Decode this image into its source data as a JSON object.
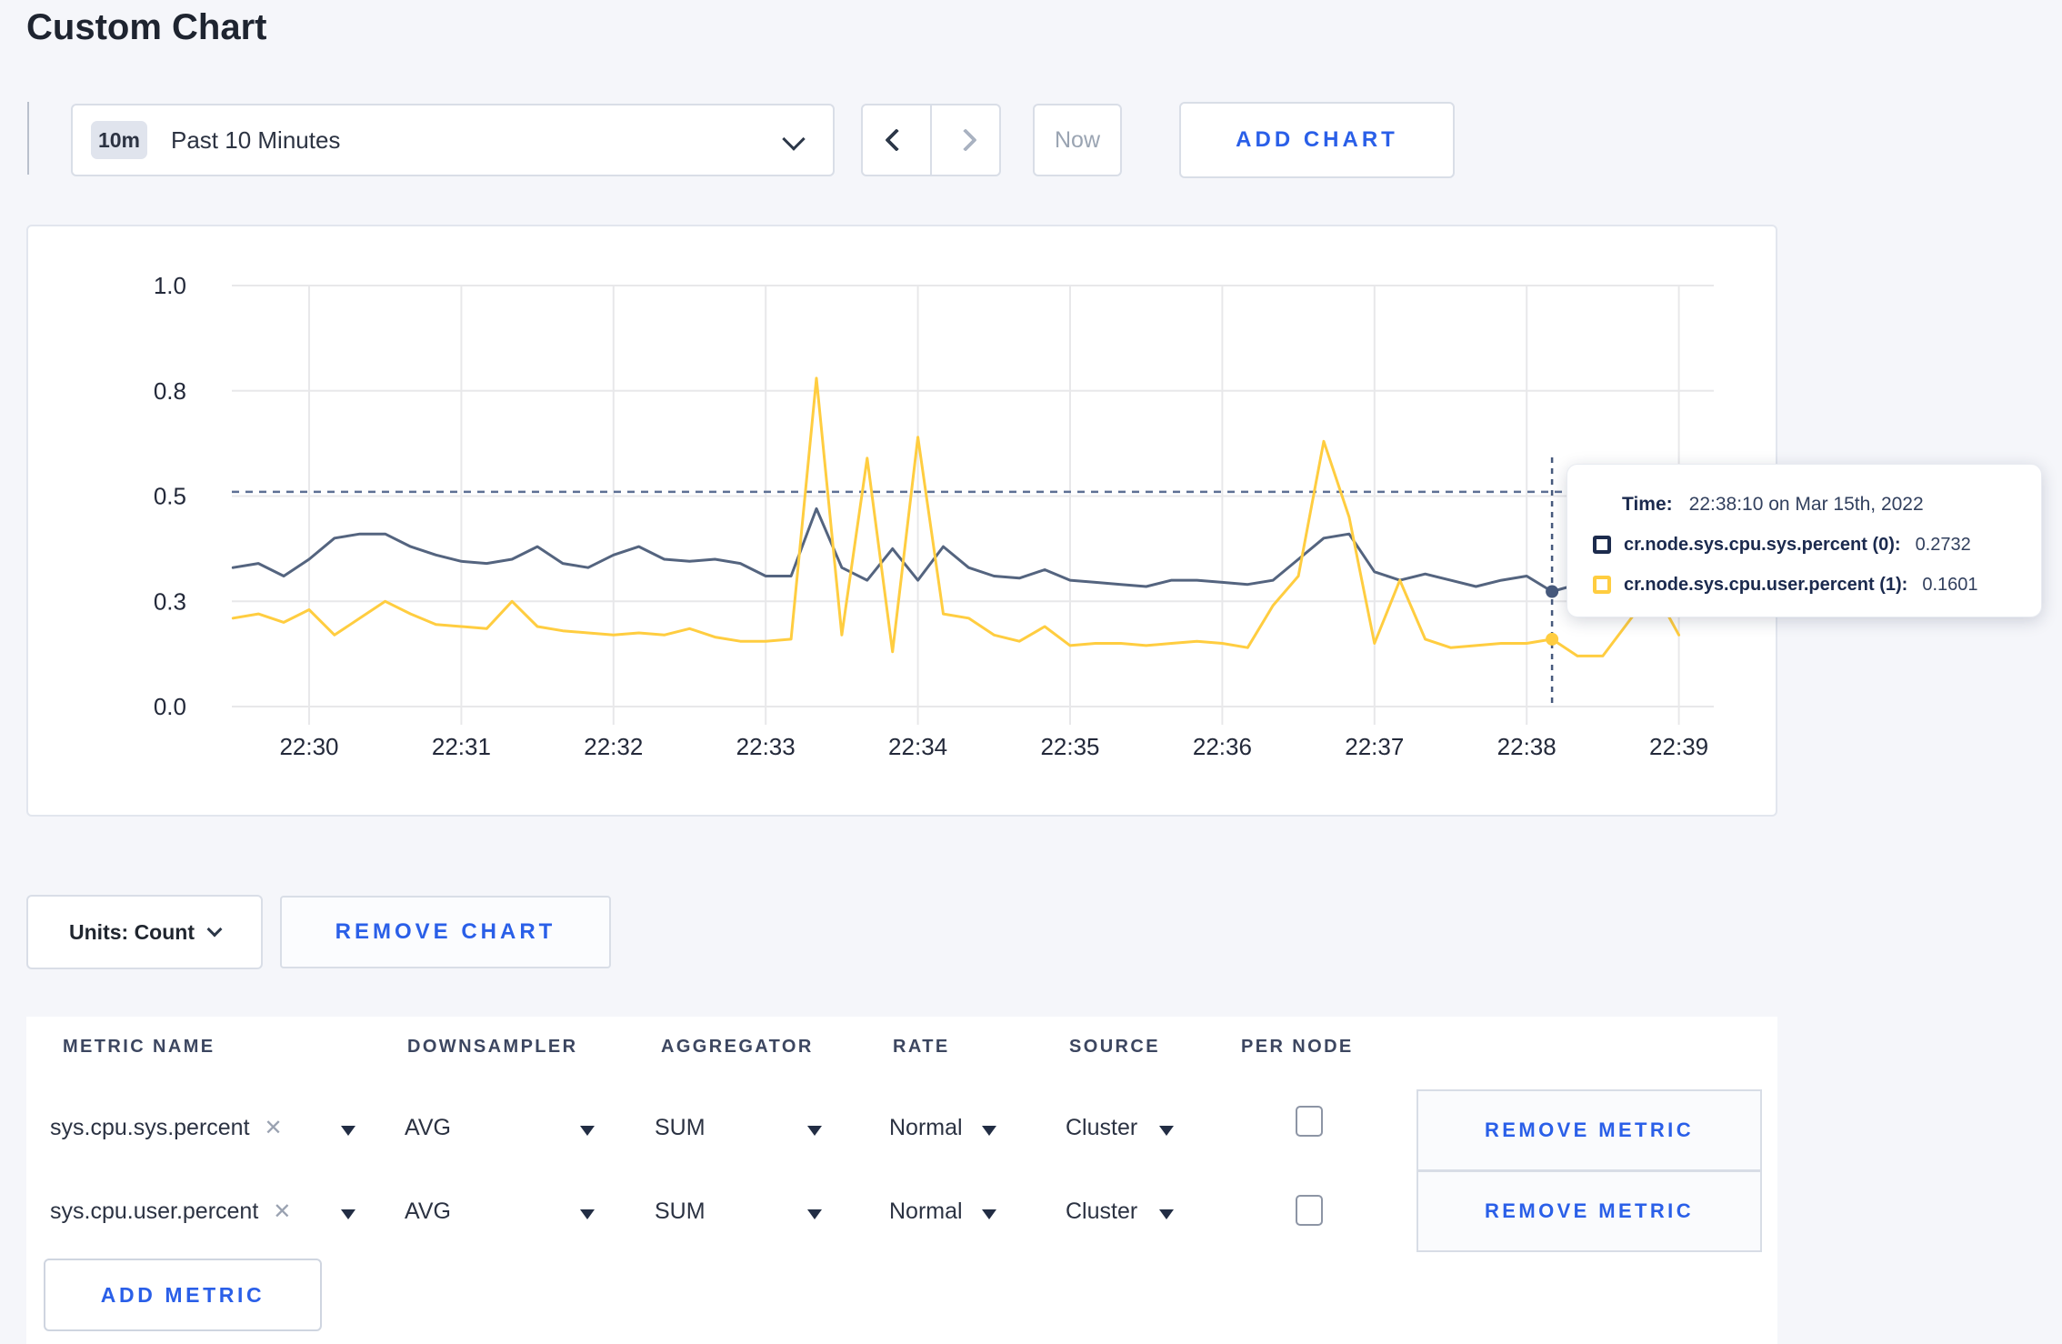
{
  "page": {
    "title": "Custom Chart"
  },
  "toolbar": {
    "time_range": {
      "badge": "10m",
      "label": "Past 10 Minutes"
    },
    "now_label": "Now",
    "add_chart_label": "ADD CHART"
  },
  "icons": {
    "time_range_chevron": "chevron-down",
    "prev": "chevron-left",
    "next": "chevron-right",
    "units_chevron": "chevron-down",
    "dropdown_caret": "triangle-down",
    "clear_metric": "x",
    "tooltip_swatch": "outlined-square"
  },
  "colors": {
    "accent_blue": "#2a5fe8",
    "series_sys": "#54647f",
    "series_user": "#ffcd40",
    "threshold_line": "#5d7094",
    "crosshair": "#46597c",
    "gridline": "#e8e8ea",
    "page_bg": "#f5f6fa"
  },
  "chart_data": {
    "type": "line",
    "title": "",
    "xlabel": "",
    "ylabel": "",
    "ylim": [
      0,
      1
    ],
    "grid": true,
    "legend_position": "tooltip",
    "y_axis_ticks": [
      {
        "label": "0.0",
        "value": 0
      },
      {
        "label": "0.3",
        "value": 0.25
      },
      {
        "label": "0.5",
        "value": 0.5
      },
      {
        "label": "0.8",
        "value": 0.75
      },
      {
        "label": "1.0",
        "value": 1
      }
    ],
    "x_axis_ticks": [
      "22:30",
      "22:31",
      "22:32",
      "22:33",
      "22:34",
      "22:35",
      "22:36",
      "22:37",
      "22:38",
      "22:39"
    ],
    "max_line_value": 0.51,
    "crosshair": {
      "time": "22:38:10",
      "values": [
        0.2732,
        0.1601
      ]
    },
    "x_times": [
      "22:29:30",
      "22:29:40",
      "22:29:50",
      "22:30:00",
      "22:30:10",
      "22:30:20",
      "22:30:30",
      "22:30:40",
      "22:30:50",
      "22:31:00",
      "22:31:10",
      "22:31:20",
      "22:31:30",
      "22:31:40",
      "22:31:50",
      "22:32:00",
      "22:32:10",
      "22:32:20",
      "22:32:30",
      "22:32:40",
      "22:32:50",
      "22:33:00",
      "22:33:10",
      "22:33:20",
      "22:33:30",
      "22:33:40",
      "22:33:50",
      "22:34:00",
      "22:34:10",
      "22:34:20",
      "22:34:30",
      "22:34:40",
      "22:34:50",
      "22:35:00",
      "22:35:10",
      "22:35:20",
      "22:35:30",
      "22:35:40",
      "22:35:50",
      "22:36:00",
      "22:36:10",
      "22:36:20",
      "22:36:30",
      "22:36:40",
      "22:36:50",
      "22:37:00",
      "22:37:10",
      "22:37:20",
      "22:37:30",
      "22:37:40",
      "22:37:50",
      "22:38:00",
      "22:38:10",
      "22:38:20",
      "22:38:30",
      "22:38:40",
      "22:38:50",
      "22:39:00"
    ],
    "series": [
      {
        "name": "cr.node.sys.cpu.sys.percent (0)",
        "color": "#54647f",
        "values": [
          0.33,
          0.34,
          0.31,
          0.35,
          0.4,
          0.41,
          0.41,
          0.38,
          0.36,
          0.345,
          0.34,
          0.35,
          0.38,
          0.34,
          0.33,
          0.36,
          0.38,
          0.35,
          0.345,
          0.35,
          0.34,
          0.31,
          0.31,
          0.47,
          0.33,
          0.3,
          0.375,
          0.3,
          0.38,
          0.33,
          0.31,
          0.305,
          0.325,
          0.3,
          0.295,
          0.29,
          0.285,
          0.3,
          0.3,
          0.295,
          0.29,
          0.3,
          0.35,
          0.4,
          0.41,
          0.32,
          0.3,
          0.315,
          0.3,
          0.285,
          0.3,
          0.31,
          0.2732,
          0.29,
          0.3,
          0.3,
          0.295,
          0.3
        ]
      },
      {
        "name": "cr.node.sys.cpu.user.percent (1)",
        "color": "#ffcd40",
        "values": [
          0.21,
          0.22,
          0.2,
          0.23,
          0.17,
          0.21,
          0.25,
          0.22,
          0.195,
          0.19,
          0.185,
          0.25,
          0.19,
          0.18,
          0.175,
          0.17,
          0.175,
          0.17,
          0.185,
          0.165,
          0.155,
          0.155,
          0.16,
          0.78,
          0.17,
          0.59,
          0.13,
          0.64,
          0.22,
          0.21,
          0.17,
          0.155,
          0.19,
          0.145,
          0.15,
          0.15,
          0.145,
          0.15,
          0.155,
          0.15,
          0.14,
          0.24,
          0.31,
          0.63,
          0.45,
          0.15,
          0.3,
          0.16,
          0.14,
          0.145,
          0.15,
          0.15,
          0.1601,
          0.12,
          0.12,
          0.2,
          0.28,
          0.17
        ]
      }
    ]
  },
  "tooltip": {
    "time_label": "Time:",
    "time_value": "22:38:10 on Mar 15th, 2022",
    "rows": [
      {
        "name": "cr.node.sys.cpu.sys.percent (0):",
        "value": "0.2732",
        "swatch_color": "#1c2b4d"
      },
      {
        "name": "cr.node.sys.cpu.user.percent (1):",
        "value": "0.1601",
        "swatch_color": "#ffcd40"
      }
    ]
  },
  "chart_footer": {
    "units_label": "Units: Count",
    "remove_chart_label": "REMOVE CHART"
  },
  "metrics": {
    "headers": [
      "METRIC NAME",
      "DOWNSAMPLER",
      "AGGREGATOR",
      "RATE",
      "SOURCE",
      "PER NODE"
    ],
    "rows": [
      {
        "name": "sys.cpu.sys.percent",
        "downsampler": "AVG",
        "aggregator": "SUM",
        "rate": "Normal",
        "source": "Cluster",
        "per_node_checked": false,
        "remove_label": "REMOVE METRIC"
      },
      {
        "name": "sys.cpu.user.percent",
        "downsampler": "AVG",
        "aggregator": "SUM",
        "rate": "Normal",
        "source": "Cluster",
        "per_node_checked": false,
        "remove_label": "REMOVE METRIC"
      }
    ],
    "add_metric_label": "ADD METRIC"
  }
}
